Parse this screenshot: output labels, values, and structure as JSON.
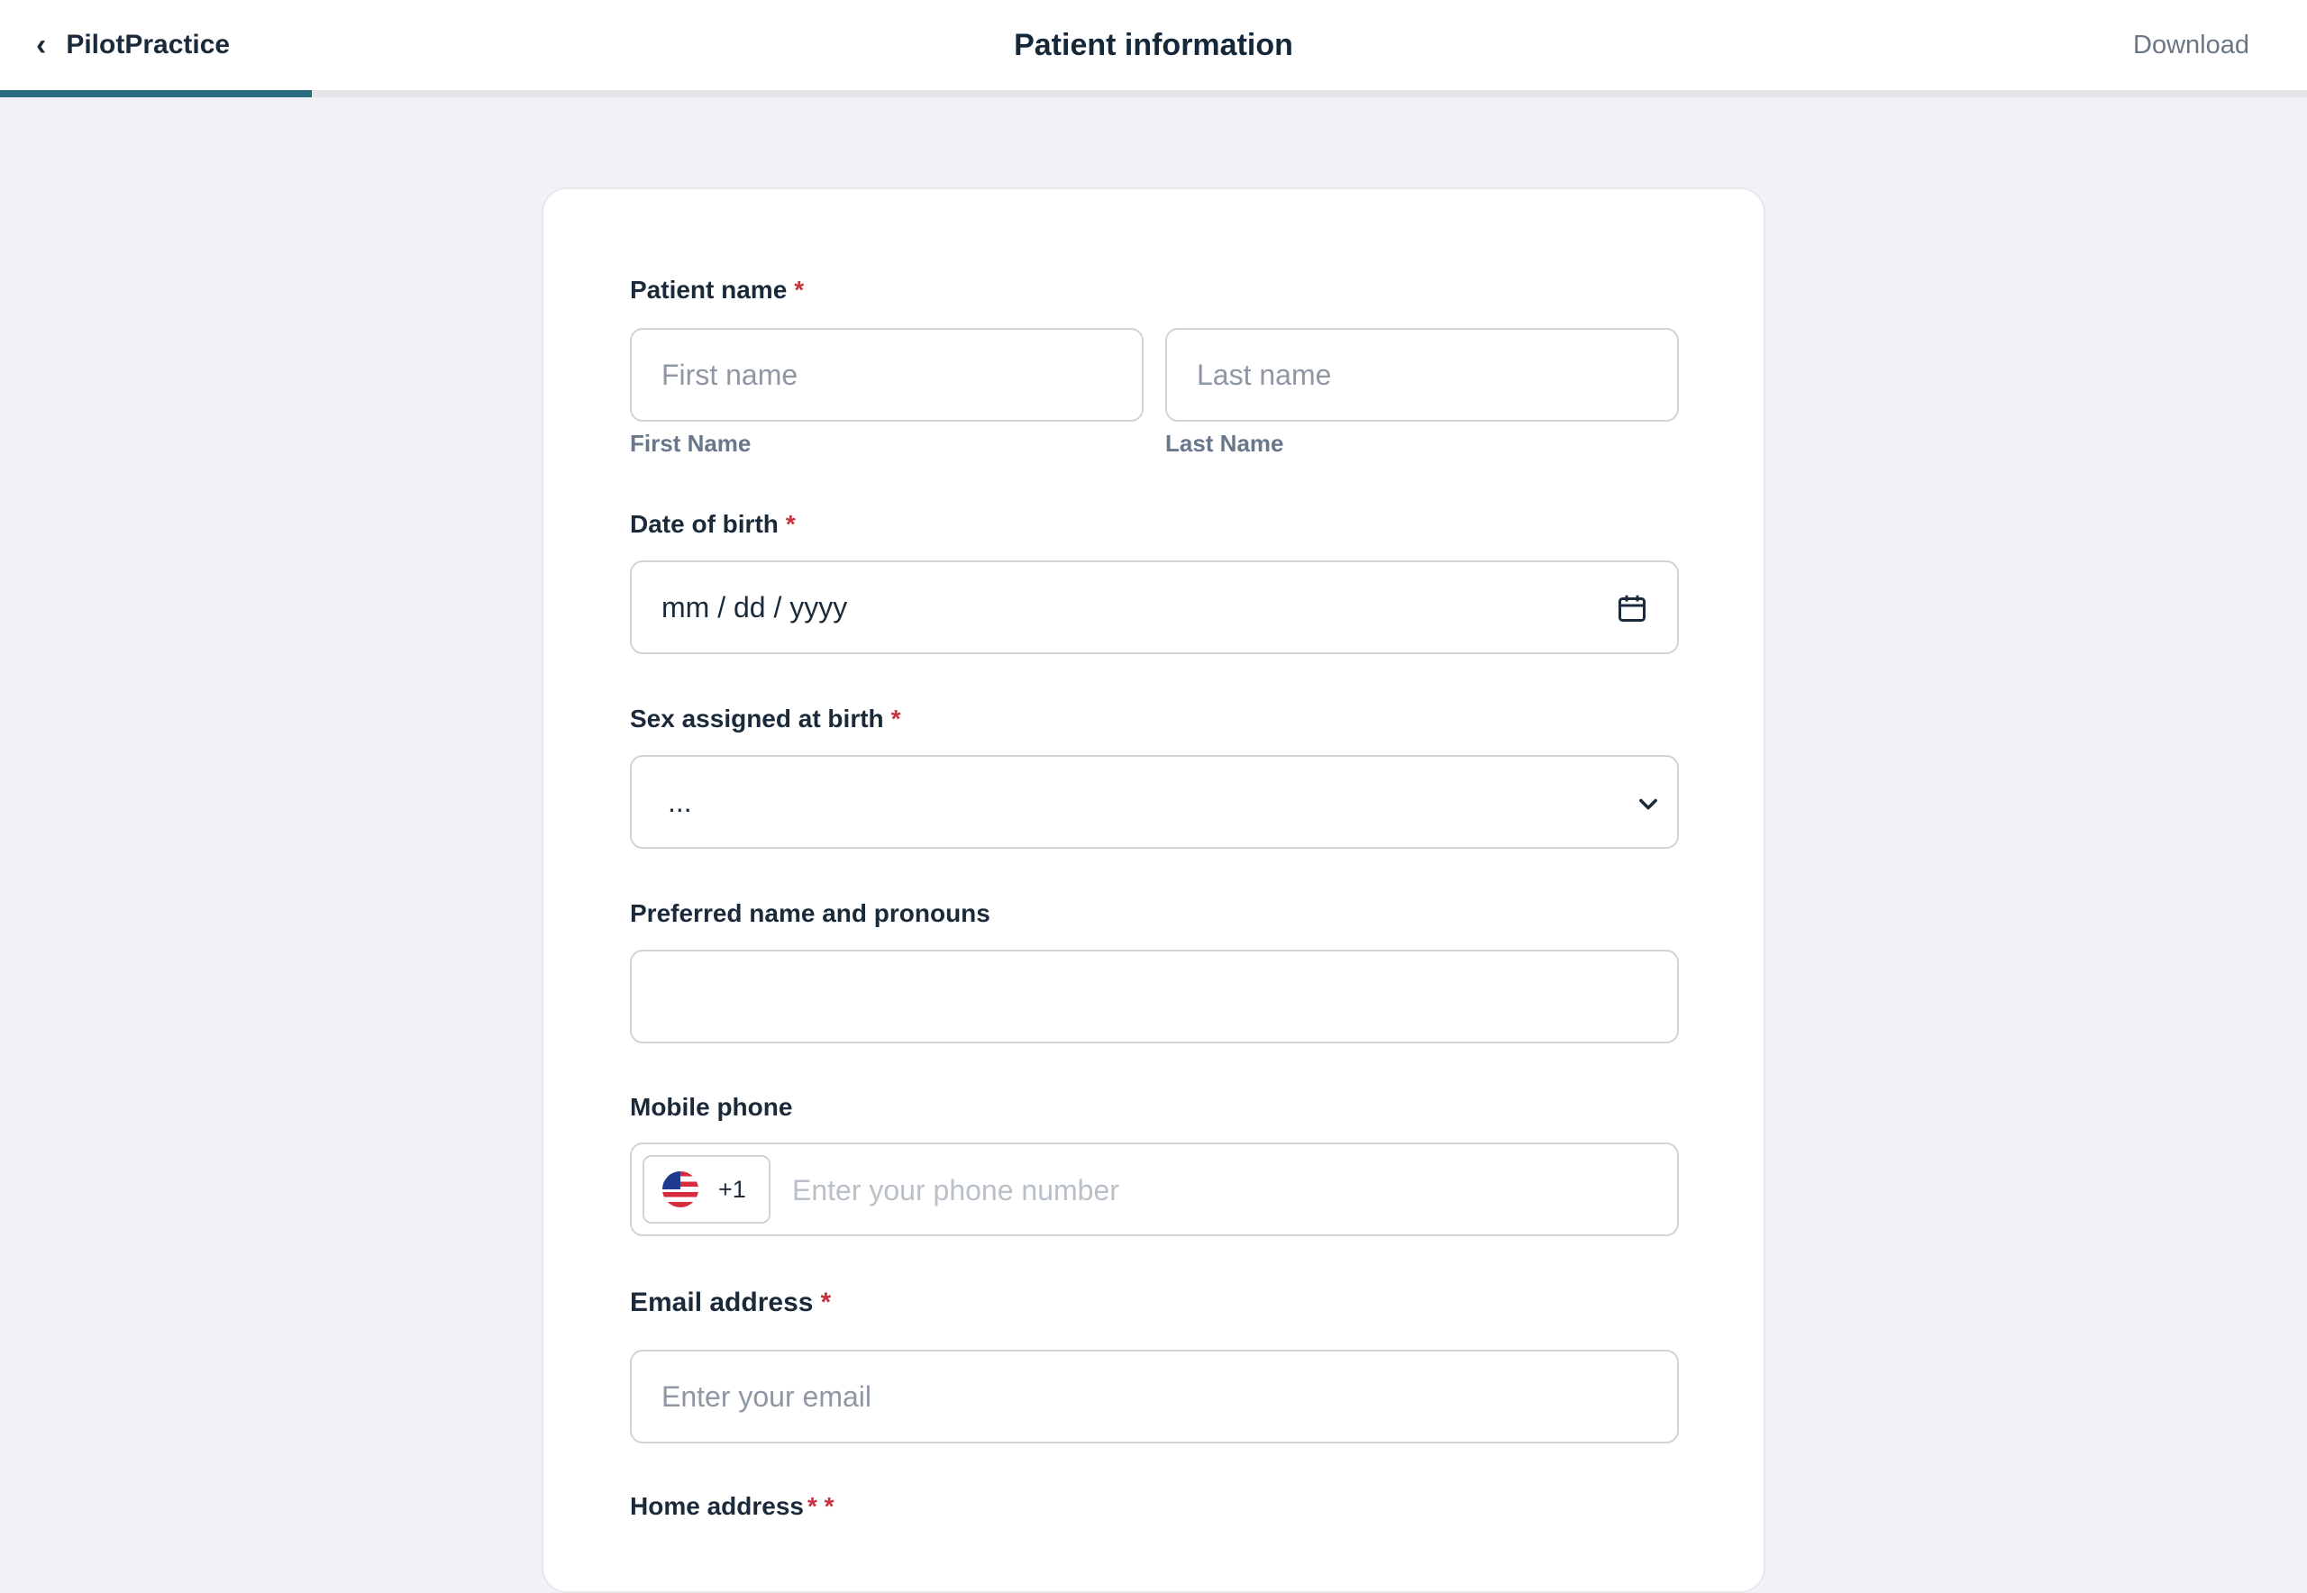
{
  "header": {
    "back_label": "PilotPractice",
    "title": "Patient information",
    "download_label": "Download",
    "progress_fraction": 0.135
  },
  "form": {
    "patient_name": {
      "label": "Patient name",
      "required_mark": "*",
      "first_placeholder": "First name",
      "last_placeholder": "Last name",
      "first_sublabel": "First Name",
      "last_sublabel": "Last Name"
    },
    "dob": {
      "label": "Date of birth",
      "required_mark": "*",
      "placeholder": "mm / dd / yyyy"
    },
    "sex": {
      "label": "Sex assigned at birth",
      "required_mark": "*",
      "selected_value": "..."
    },
    "preferred": {
      "label": "Preferred name and pronouns",
      "value": ""
    },
    "phone": {
      "label": "Mobile phone",
      "country_code": "+1",
      "placeholder": "Enter your phone number"
    },
    "email": {
      "label": "Email address",
      "required_mark": "*",
      "placeholder": "Enter your email"
    },
    "home_address": {
      "label": "Home address",
      "required_mark": "* *"
    }
  },
  "icons": {
    "back": "chevron-left-icon",
    "calendar": "calendar-icon",
    "dropdown": "chevron-down-icon",
    "flag": "us-flag-icon"
  },
  "colors": {
    "accent": "#2b6b80",
    "required": "#c8323c",
    "background": "#f0f2f5"
  }
}
